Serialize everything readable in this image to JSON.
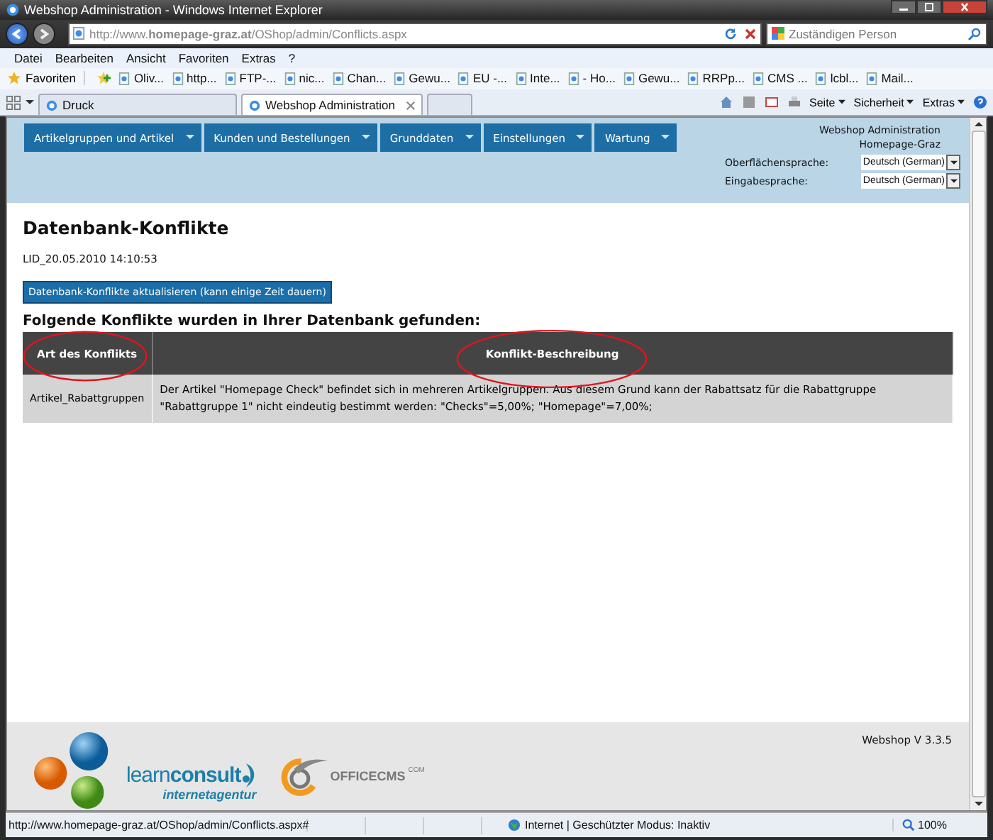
{
  "window": {
    "title": "Webshop Administration - Windows Internet Explorer"
  },
  "address_bar": {
    "url": "http://www.**homepage-graz.at**/OShop/admin/Conflicts.aspx"
  },
  "search": {
    "placeholder": "Zuständigen Person"
  },
  "menu": [
    "Datei",
    "Bearbeiten",
    "Ansicht",
    "Favoriten",
    "Extras",
    "?"
  ],
  "favorites_bar": {
    "label": "Favoriten",
    "links": [
      "Oliv...",
      "http...",
      "FTP-...",
      "nic...",
      "Chan...",
      "Gewu...",
      "EU -...",
      "Inte...",
      "- Ho...",
      "Gewu...",
      "RRPp...",
      "CMS ...",
      "lcbl...",
      "Mail..."
    ]
  },
  "tabs": [
    {
      "label": "Druck",
      "selected": false
    },
    {
      "label": "Webshop Administration",
      "selected": true
    }
  ],
  "command_bar": [
    "Seite",
    "Sicherheit",
    "Extras"
  ],
  "page": {
    "nav": [
      "Artikelgruppen und Artikel",
      "Kunden und Bestellungen",
      "Grunddaten",
      "Einstellungen",
      "Wartung"
    ],
    "header_info": [
      "Webshop Administration",
      "Homepage-Graz"
    ],
    "language_fields": [
      {
        "label": "Oberflächensprache:",
        "value": "Deutsch (German)"
      },
      {
        "label": "Eingabesprache:",
        "value": "Deutsch (German)"
      }
    ],
    "heading": "Datenbank-Konflikte",
    "timestamp": "LID_20.05.2010 14:10:53",
    "refresh_button": "Datenbank-Konflikte aktualisieren (kann einige Zeit dauern)",
    "subheading": "Folgende Konflikte wurden in Ihrer Datenbank gefunden:",
    "table": {
      "columns": [
        "Art des Konflikts",
        "Konflikt-Beschreibung"
      ],
      "rows": [
        [
          "Artikel_Rabattgruppen",
          "Der Artikel \"Homepage Check\" befindet sich in mehreren Artikelgruppen. Aus diesem Grund kann der Rabattsatz für die Rabattgruppe \"Rabattgruppe 1\" nicht eindeutig bestimmt werden: \"Checks\"=5,00%; \"Homepage\"=7,00%;"
        ]
      ]
    },
    "version": "Webshop V 3.3.5",
    "logos": {
      "learnconsult": "learn**consult**",
      "learnconsult_tagline": "internetagentur",
      "officecms": "OFFICE**CMS**",
      "officecms_suffix": "COM"
    }
  },
  "status_bar": {
    "url": "http://www.homepage-graz.at/OShop/admin/Conflicts.aspx#",
    "zone": "Internet | Geschützter Modus: Inaktiv",
    "zoom": "100%"
  }
}
